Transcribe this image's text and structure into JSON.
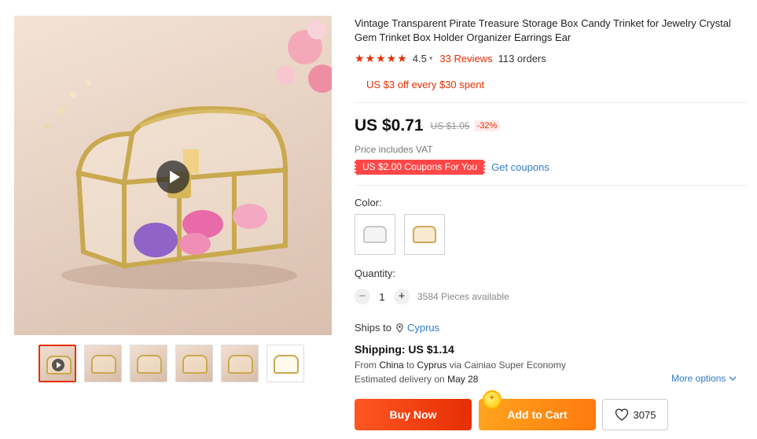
{
  "product": {
    "title": "Vintage Transparent Pirate Treasure Storage Box Candy Trinket for Jewelry Crystal Gem Trinket Box Holder Organizer Earrings Ear",
    "stars": "★★★★★",
    "rating": "4.5",
    "reviews": "33 Reviews",
    "orders": "113 orders",
    "promo": "US $3 off every $30 spent",
    "price": "US $0.71",
    "old_price": "US $1.05",
    "discount": "-32%",
    "vat_note": "Price includes VAT",
    "coupon_tag": "US $2.00 Coupons For You",
    "get_coupons": "Get coupons"
  },
  "options": {
    "color_label": "Color:",
    "quantity_label": "Quantity:",
    "quantity_value": "1",
    "minus": "−",
    "plus": "+",
    "available": "3584 Pieces available"
  },
  "shipping": {
    "ships_to_label": "Ships to",
    "country": "Cyprus",
    "title": "Shipping: US $1.14",
    "from_label": "From",
    "from": "China",
    "to_label": "to",
    "to": "Cyprus",
    "via": "via Cainiao Super Economy",
    "delivery_label": "Estimated delivery on",
    "delivery_date": "May 28",
    "more_options": "More options"
  },
  "actions": {
    "buy_now": "Buy Now",
    "add_to_cart": "Add to Cart",
    "wishlist_count": "3075"
  },
  "colors": {
    "accent_red": "#e62e04",
    "link_blue": "#2e7bcf",
    "cart_orange": "#ff8c14"
  }
}
